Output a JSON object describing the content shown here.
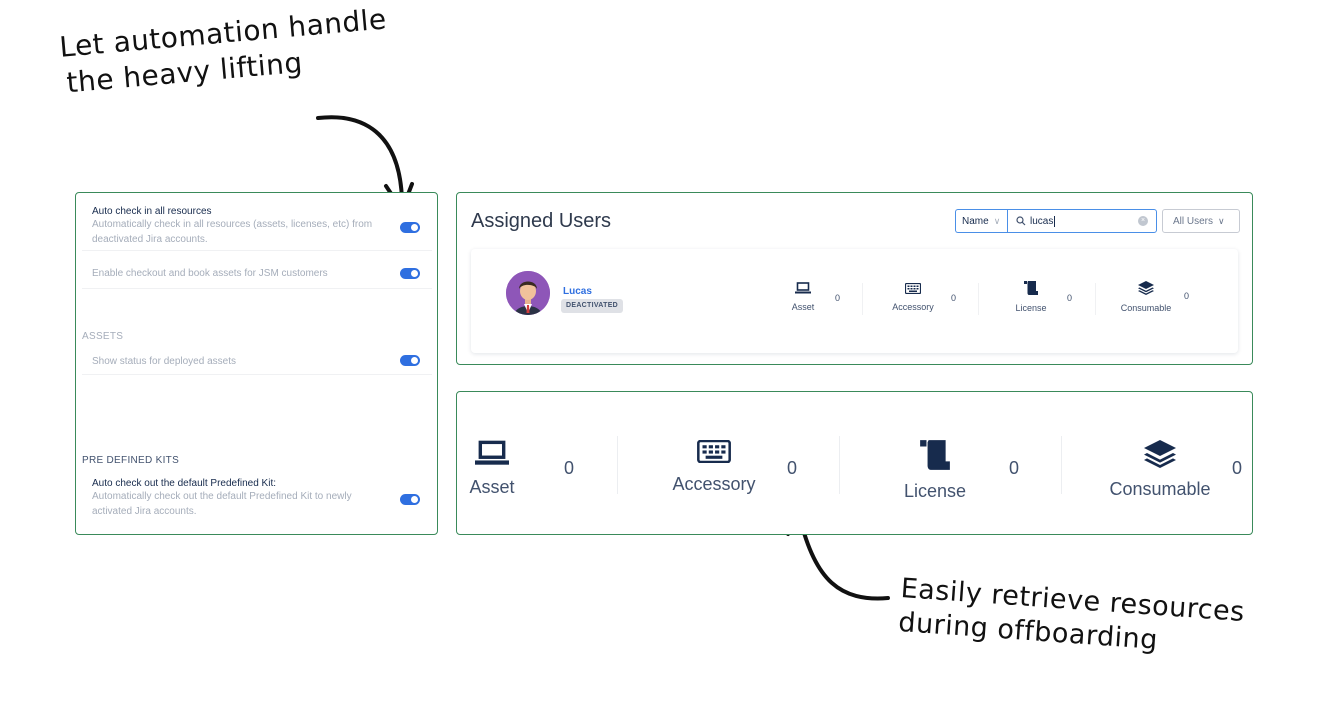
{
  "annotations": {
    "top_line1": "Let automation handle",
    "top_line2": "the heavy lifting",
    "bottom_line1": "Easily retrieve resources",
    "bottom_line2": "during offboarding"
  },
  "settings": {
    "rows": [
      {
        "title": "Auto check in all resources",
        "description": "Automatically check in all resources (assets, licenses, etc) from deactivated Jira accounts.",
        "enabled": true
      },
      {
        "title": "Enable checkout and book assets for JSM customers",
        "enabled": true
      },
      {
        "title": "Show status for deployed assets",
        "enabled": true
      },
      {
        "title": "Auto check out the default Predefined Kit:",
        "description": "Automatically check out the default Predefined Kit to newly activated Jira accounts.",
        "enabled": true
      }
    ],
    "section_assets": "ASSETS",
    "section_kits": "PRE DEFINED KITS"
  },
  "assigned_users": {
    "title": "Assigned Users",
    "filter_field": "Name",
    "search_value": "lucas",
    "user_filter": "All Users",
    "user": {
      "name": "Lucas",
      "status": "DEACTIVATED",
      "resources": [
        {
          "label": "Asset",
          "count": "0"
        },
        {
          "label": "Accessory",
          "count": "0"
        },
        {
          "label": "License",
          "count": "0"
        },
        {
          "label": "Consumable",
          "count": "0"
        }
      ]
    }
  },
  "resource_totals": [
    {
      "label": "Asset",
      "count": "0"
    },
    {
      "label": "Accessory",
      "count": "0"
    },
    {
      "label": "License",
      "count": "0"
    },
    {
      "label": "Consumable",
      "count": "0"
    }
  ],
  "colors": {
    "toggle_on": "#2f6fe0",
    "panel_border": "#3a8a5a",
    "link": "#2f6fe0"
  }
}
